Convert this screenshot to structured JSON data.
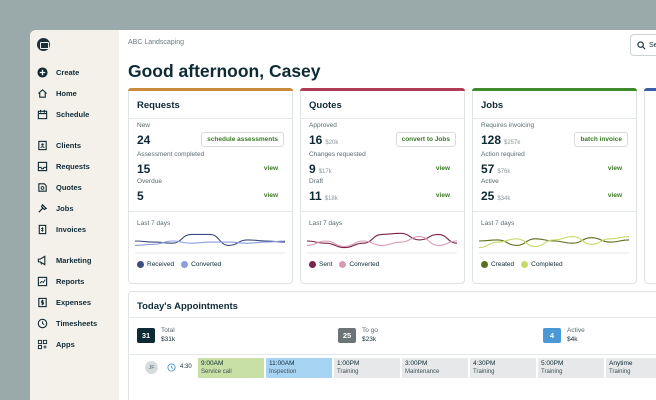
{
  "sidebar": {
    "items": [
      {
        "label": "Create",
        "icon": "plus-circle-icon"
      },
      {
        "label": "Home",
        "icon": "home-icon"
      },
      {
        "label": "Schedule",
        "icon": "calendar-icon"
      },
      {
        "label": "Clients",
        "icon": "address-book-icon"
      },
      {
        "label": "Requests",
        "icon": "inbox-icon"
      },
      {
        "label": "Quotes",
        "icon": "quote-icon"
      },
      {
        "label": "Jobs",
        "icon": "hammer-icon"
      },
      {
        "label": "Invoices",
        "icon": "invoice-icon"
      },
      {
        "label": "Marketing",
        "icon": "megaphone-icon"
      },
      {
        "label": "Reports",
        "icon": "chart-icon"
      },
      {
        "label": "Expenses",
        "icon": "dollar-icon"
      },
      {
        "label": "Timesheets",
        "icon": "clock-icon"
      },
      {
        "label": "Apps",
        "icon": "apps-icon"
      }
    ]
  },
  "header": {
    "company": "ABC Landscaping",
    "search_label": "Se",
    "greeting": "Good afternoon, Casey"
  },
  "cards": [
    {
      "title": "Requests",
      "accent": "#c98a3a",
      "metrics": [
        {
          "label": "New",
          "value": "24",
          "sub": "",
          "action": "schedule assessments"
        },
        {
          "label": "Assessment completed",
          "value": "15",
          "sub": "",
          "action": "view"
        },
        {
          "label": "Overdue",
          "value": "5",
          "sub": "",
          "action": "view"
        }
      ],
      "last7": "Last 7 days",
      "legend": [
        {
          "label": "Received",
          "color": "#3d4d80"
        },
        {
          "label": "Converted",
          "color": "#8a9ee0"
        }
      ],
      "series": [
        [
          0.5,
          0.55,
          0.6,
          0.2,
          0.2,
          0.7,
          0.45,
          0.5,
          0.55
        ],
        [
          0.7,
          0.65,
          0.5,
          0.6,
          0.55,
          0.55,
          0.6,
          0.55,
          0.5
        ]
      ]
    },
    {
      "title": "Quotes",
      "accent": "#b13b55",
      "metrics": [
        {
          "label": "Approved",
          "value": "16",
          "sub": "$20k",
          "action": "convert to Jobs"
        },
        {
          "label": "Changes requested",
          "value": "9",
          "sub": "$17k",
          "action": "view"
        },
        {
          "label": "Draft",
          "value": "11",
          "sub": "$18k",
          "action": "view"
        }
      ],
      "last7": "Last 7 days",
      "legend": [
        {
          "label": "Sent",
          "color": "#7a2248"
        },
        {
          "label": "Converted",
          "color": "#d99ab8"
        }
      ],
      "series": [
        [
          0.5,
          0.6,
          0.8,
          0.6,
          0.2,
          0.15,
          0.45,
          0.2,
          0.6
        ],
        [
          0.7,
          0.5,
          0.75,
          0.5,
          0.7,
          0.55,
          0.3,
          0.7,
          0.5
        ]
      ]
    },
    {
      "title": "Jobs",
      "accent": "#3f8a2b",
      "metrics": [
        {
          "label": "Requires invoicing",
          "value": "128",
          "sub": "$257k",
          "action": "batch invoice"
        },
        {
          "label": "Action required",
          "value": "57",
          "sub": "$76k",
          "action": "view"
        },
        {
          "label": "Active",
          "value": "25",
          "sub": "$34k",
          "action": "view"
        }
      ],
      "last7": "Last 7 days",
      "legend": [
        {
          "label": "Created",
          "color": "#5a6e1a"
        },
        {
          "label": "Completed",
          "color": "#c9d86a"
        }
      ],
      "series": [
        [
          0.5,
          0.45,
          0.7,
          0.4,
          0.5,
          0.6,
          0.35,
          0.55,
          0.45
        ],
        [
          0.8,
          0.55,
          0.4,
          0.75,
          0.45,
          0.3,
          0.65,
          0.4,
          0.3
        ]
      ]
    }
  ],
  "appointments": {
    "title": "Today's Appointments",
    "stats": [
      {
        "count": "31",
        "label": "Total",
        "amount": "$31k",
        "color": "#0e2a35"
      },
      {
        "count": "25",
        "label": "To go",
        "amount": "$23k",
        "color": "#6b7578"
      },
      {
        "count": "4",
        "label": "Active",
        "amount": "$4k",
        "color": "#4a98d6"
      }
    ],
    "row": {
      "initials": "JF",
      "now": "4:30",
      "slots": [
        {
          "time": "9:00AM",
          "type": "Service call",
          "color": "#c8e0a6"
        },
        {
          "time": "11:00AM",
          "type": "Inspection",
          "color": "#a8d4f4"
        },
        {
          "time": "1:00PM",
          "type": "Training",
          "color": "#e6e8e9"
        },
        {
          "time": "3:00PM",
          "type": "Maintenance",
          "color": "#e6e8e9"
        },
        {
          "time": "4:30PM",
          "type": "Training",
          "color": "#e6e8e9"
        },
        {
          "time": "5:00PM",
          "type": "Training",
          "color": "#e6e8e9"
        },
        {
          "time": "Anytime",
          "type": "Training",
          "color": "#e6e8e9"
        }
      ]
    }
  }
}
